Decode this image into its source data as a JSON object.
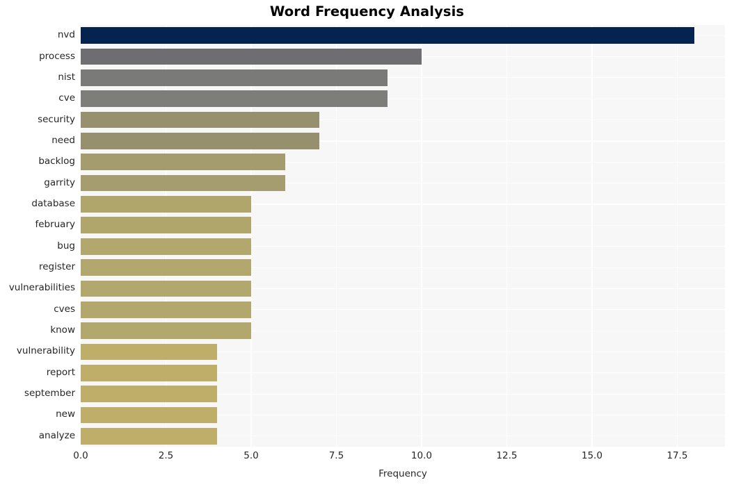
{
  "chart_data": {
    "type": "bar",
    "orientation": "horizontal",
    "title": "Word Frequency Analysis",
    "xlabel": "Frequency",
    "ylabel": "",
    "categories": [
      "nvd",
      "process",
      "nist",
      "cve",
      "security",
      "need",
      "backlog",
      "garrity",
      "database",
      "february",
      "bug",
      "register",
      "vulnerabilities",
      "cves",
      "know",
      "vulnerability",
      "report",
      "september",
      "new",
      "analyze"
    ],
    "values": [
      18,
      10,
      9,
      9,
      7,
      7,
      6,
      6,
      5,
      5,
      5,
      5,
      5,
      5,
      5,
      4,
      4,
      4,
      4,
      4
    ],
    "bar_colors": [
      "#04234f",
      "#6e6e72",
      "#7a7a79",
      "#7d7d79",
      "#96906f",
      "#96906f",
      "#a49c6f",
      "#a59d6f",
      "#b0a66c",
      "#b0a66c",
      "#b2a76c",
      "#b2a76c",
      "#b2a76c",
      "#b2a76c",
      "#b2a76c",
      "#bfae69",
      "#bfae69",
      "#bfae69",
      "#bfae69",
      "#bfae69"
    ],
    "xlim": [
      0,
      18.9
    ],
    "xticks": [
      "0.0",
      "2.5",
      "5.0",
      "7.5",
      "10.0",
      "12.5",
      "15.0",
      "17.5"
    ],
    "xtick_values": [
      0,
      2.5,
      5,
      7.5,
      10,
      12.5,
      15,
      17.5
    ],
    "grid": true,
    "grid_color": "#ffffff",
    "plot_background": "#f7f7f7",
    "figure_background": "#ffffff",
    "legend": null,
    "title_color": "#000000",
    "tick_label_color": "#262626"
  }
}
